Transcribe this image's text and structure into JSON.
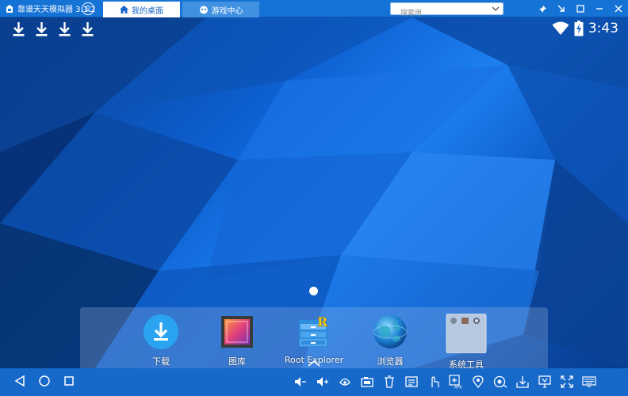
{
  "titlebar": {
    "app_title": "靠谱天天模拟器 3.1.2",
    "tabs": [
      {
        "label": "我的桌面",
        "icon": "home-icon",
        "active": true
      },
      {
        "label": "游戏中心",
        "icon": "gamepad-icon",
        "active": false
      }
    ],
    "search": {
      "placeholder": "搜索用"
    },
    "window_buttons": [
      "pin-icon",
      "shrink-icon",
      "maximize-icon",
      "minimize-icon",
      "close-icon"
    ]
  },
  "statusbar": {
    "notifications": [
      "download-icon",
      "download-icon",
      "download-icon",
      "download-icon"
    ],
    "time": "3:43"
  },
  "dock": {
    "items": [
      {
        "label": "下载",
        "icon": "download-app-icon"
      },
      {
        "label": "图库",
        "icon": "gallery-icon"
      },
      {
        "label": "Root Explorer",
        "icon": "root-explorer-icon"
      },
      {
        "label": "浏览器",
        "icon": "browser-globe-icon"
      },
      {
        "label": "系统工具",
        "icon": "system-tools-folder-icon"
      }
    ]
  },
  "bottombar": {
    "nav": [
      "back-icon",
      "home-circle-icon",
      "recents-icon"
    ],
    "tools": [
      "volume-down-icon",
      "volume-up-icon",
      "shake-icon",
      "screenshot-icon",
      "trash-icon",
      "keyboard-mapping-icon",
      "touch-icon",
      "install-apk-icon",
      "location-icon",
      "record-icon",
      "download-tray-icon",
      "screen-cast-icon",
      "fullscreen-icon",
      "keyboard-icon"
    ]
  },
  "colors": {
    "titlebar_bg": "#1673d6",
    "bottombar_bg": "#1668c9",
    "active_tab_text": "#1a66c8"
  }
}
